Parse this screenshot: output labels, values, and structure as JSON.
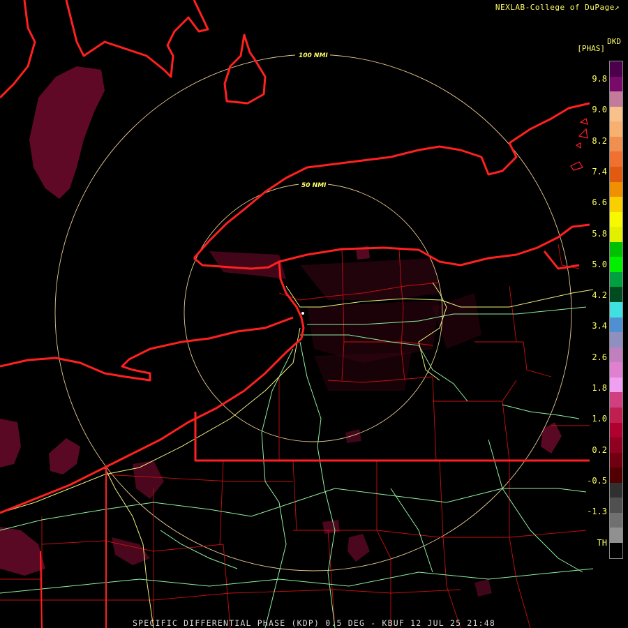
{
  "credit": "NEXLAB-College of DuPage",
  "credit_icon": "external-link-icon",
  "footer": "SPECIFIC DIFFERENTIAL PHASE (KDP) 0.5 DEG - KBUF 12 JUL 25 21:48",
  "range_rings": [
    {
      "label": "100 NMI"
    },
    {
      "label": "50 NMI"
    }
  ],
  "scale": {
    "unit_top": "DKD",
    "unit_bracket": "[PHAS]",
    "labels": [
      "9.8",
      "9.0",
      "8.2",
      "7.4",
      "6.6",
      "5.8",
      "5.0",
      "4.2",
      "3.4",
      "2.6",
      "1.8",
      "1.0",
      "0.2",
      "-0.5",
      "-1.3",
      "TH"
    ],
    "colors": [
      "#4a004a",
      "#7a0a6a",
      "#c47a9a",
      "#f8c08a",
      "#f8b070",
      "#f09050",
      "#f07030",
      "#e05a10",
      "#f09000",
      "#f8d000",
      "#f8f800",
      "#e0f000",
      "#00c000",
      "#00f000",
      "#00a040",
      "#004c20",
      "#40e0e0",
      "#5090d0",
      "#9090c0",
      "#c080c0",
      "#e080d0",
      "#f0a0f0",
      "#d04080",
      "#c02050",
      "#b00030",
      "#900020",
      "#700010",
      "#500000",
      "#303030",
      "#505050",
      "#707070",
      "#909090",
      "#000000"
    ],
    "colors_comment_free": true
  }
}
